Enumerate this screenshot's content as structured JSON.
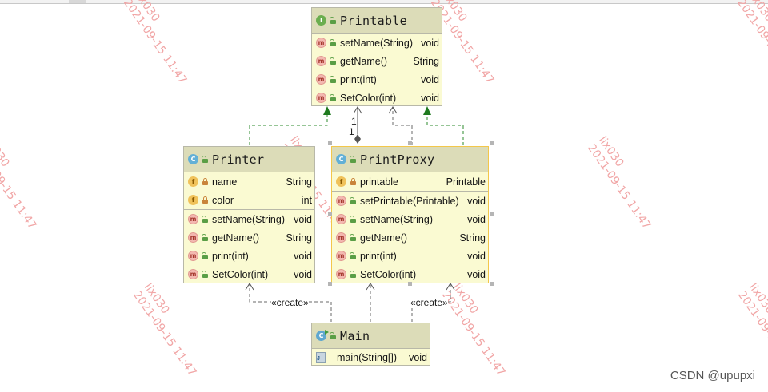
{
  "watermark": {
    "user": "lix030",
    "date": "2021-09-15 11:47"
  },
  "credit": "CSDN @upupxi",
  "classes": {
    "printable": {
      "kind": "I",
      "name": "Printable",
      "methods": [
        {
          "name": "setName(String)",
          "type": "void"
        },
        {
          "name": "getName()",
          "type": "String"
        },
        {
          "name": "print(int)",
          "type": "void"
        },
        {
          "name": "SetColor(int)",
          "type": "void"
        }
      ]
    },
    "printer": {
      "kind": "C",
      "name": "Printer",
      "fields": [
        {
          "name": "name",
          "type": "String"
        },
        {
          "name": "color",
          "type": "int"
        }
      ],
      "methods": [
        {
          "name": "setName(String)",
          "type": "void"
        },
        {
          "name": "getName()",
          "type": "String"
        },
        {
          "name": "print(int)",
          "type": "void"
        },
        {
          "name": "SetColor(int)",
          "type": "void"
        }
      ]
    },
    "printproxy": {
      "kind": "C",
      "name": "PrintProxy",
      "fields": [
        {
          "name": "printable",
          "type": "Printable"
        }
      ],
      "methods": [
        {
          "name": "setPrintable(Printable)",
          "type": "void"
        },
        {
          "name": "setName(String)",
          "type": "void"
        },
        {
          "name": "getName()",
          "type": "String"
        },
        {
          "name": "print(int)",
          "type": "void"
        },
        {
          "name": "SetColor(int)",
          "type": "void"
        }
      ]
    },
    "main": {
      "kind": "C",
      "name": "Main",
      "methods": [
        {
          "name": "main(String[])",
          "type": "void"
        }
      ]
    }
  },
  "icons": {
    "method": "m",
    "field": "f"
  },
  "relations": {
    "multiplicity_a": "1",
    "multiplicity_b": "1",
    "create_label_1": "«create»",
    "create_label_2": "«create»"
  },
  "colors": {
    "realization": "#2e8b2e",
    "dependency": "#555555",
    "class_fill": "#fafad2",
    "header_fill": "#dcdcb8",
    "watermark": "#f1a6a6"
  }
}
